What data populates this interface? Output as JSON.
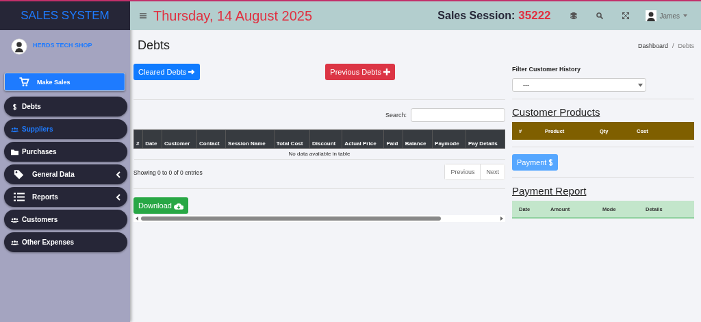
{
  "sidebar": {
    "title": "SALES SYSTEM",
    "shop_name": "HERDS TECH SHOP",
    "items": [
      {
        "label": "Make Sales",
        "kind": "cart",
        "selected": true,
        "hover": false,
        "has_submenu": false
      },
      {
        "label": "Debts",
        "kind": "dollar",
        "selected": false,
        "hover": false,
        "has_submenu": false
      },
      {
        "label": "Suppliers",
        "kind": "users",
        "selected": false,
        "hover": true,
        "has_submenu": false
      },
      {
        "label": "Purchases",
        "kind": "folder",
        "selected": false,
        "hover": false,
        "has_submenu": false
      },
      {
        "label": "General Data",
        "kind": "tag",
        "selected": false,
        "hover": false,
        "has_submenu": true
      },
      {
        "label": "Reports",
        "kind": "list",
        "selected": false,
        "hover": false,
        "has_submenu": true
      },
      {
        "label": "Customers",
        "kind": "users",
        "selected": false,
        "hover": false,
        "has_submenu": false
      },
      {
        "label": "Other Expenses",
        "kind": "users",
        "selected": false,
        "hover": false,
        "has_submenu": false
      }
    ]
  },
  "header": {
    "date": "Thursday, 14 August 2025",
    "session_label": "Sales Session:",
    "session_number": "35222",
    "user": "James"
  },
  "page": {
    "title": "Debts",
    "breadcrumb": [
      "Dashboard",
      "Debts"
    ],
    "breadcrumb_separator": "/"
  },
  "buttons": {
    "cleared": "Cleared Debts",
    "previous": "Previous Debts",
    "download": "Download",
    "payment": "Payment"
  },
  "table": {
    "search_label": "Search:",
    "columns": [
      "#",
      "Date",
      "Customer",
      "Contact",
      "Session Name",
      "Total Cost",
      "Discount",
      "Actual Price",
      "Paid",
      "Balance",
      "Paymode",
      "Pay Details"
    ],
    "empty": "No data available in table",
    "info": "Showing 0 to 0 of 0 entries",
    "pagination": [
      "Previous",
      "Next"
    ]
  },
  "filter": {
    "label": "Filter Customer History",
    "value": "---"
  },
  "customer_products": {
    "title": "Customer Products",
    "columns": [
      "#",
      "Product",
      "Qty",
      "Cost"
    ]
  },
  "payment_report": {
    "title": "Payment Report",
    "columns": [
      "Date",
      "Amount",
      "Mode",
      "Details"
    ]
  }
}
